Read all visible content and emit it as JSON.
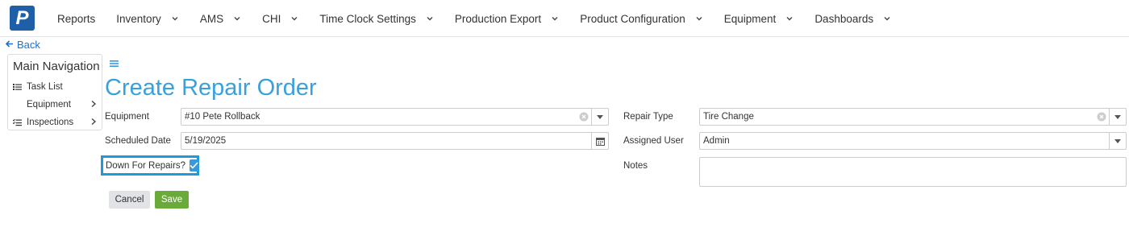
{
  "app": {
    "logo_letter": "P"
  },
  "topnav": {
    "items": [
      {
        "label": "Reports",
        "has_dropdown": false
      },
      {
        "label": "Inventory",
        "has_dropdown": true
      },
      {
        "label": "AMS",
        "has_dropdown": true
      },
      {
        "label": "CHI",
        "has_dropdown": true
      },
      {
        "label": "Time Clock Settings",
        "has_dropdown": true
      },
      {
        "label": "Production Export",
        "has_dropdown": true
      },
      {
        "label": "Product Configuration",
        "has_dropdown": true
      },
      {
        "label": "Equipment",
        "has_dropdown": true
      },
      {
        "label": "Dashboards",
        "has_dropdown": true
      }
    ]
  },
  "back": {
    "label": "Back"
  },
  "sidenav": {
    "title": "Main Navigation",
    "items": [
      {
        "label": "Task List",
        "icon": "list-icon"
      },
      {
        "label": "Equipment",
        "icon": ""
      },
      {
        "label": "Inspections",
        "icon": "checklist-icon"
      }
    ]
  },
  "page": {
    "title": "Create Repair Order"
  },
  "form": {
    "equipment": {
      "label": "Equipment",
      "value": "#10  Pete Rollback"
    },
    "scheduled_date": {
      "label": "Scheduled Date",
      "value": "5/19/2025"
    },
    "down_for_repairs": {
      "label": "Down For Repairs?",
      "checked": true
    },
    "repair_type": {
      "label": "Repair Type",
      "value": "Tire Change"
    },
    "assigned_user": {
      "label": "Assigned User",
      "value": "Admin"
    },
    "notes": {
      "label": "Notes",
      "value": ""
    }
  },
  "buttons": {
    "cancel": "Cancel",
    "save": "Save"
  },
  "colors": {
    "accent": "#3aa0dc",
    "logo": "#1f5fa8",
    "save": "#6aaa3b",
    "highlight": "#1e9ad6"
  }
}
